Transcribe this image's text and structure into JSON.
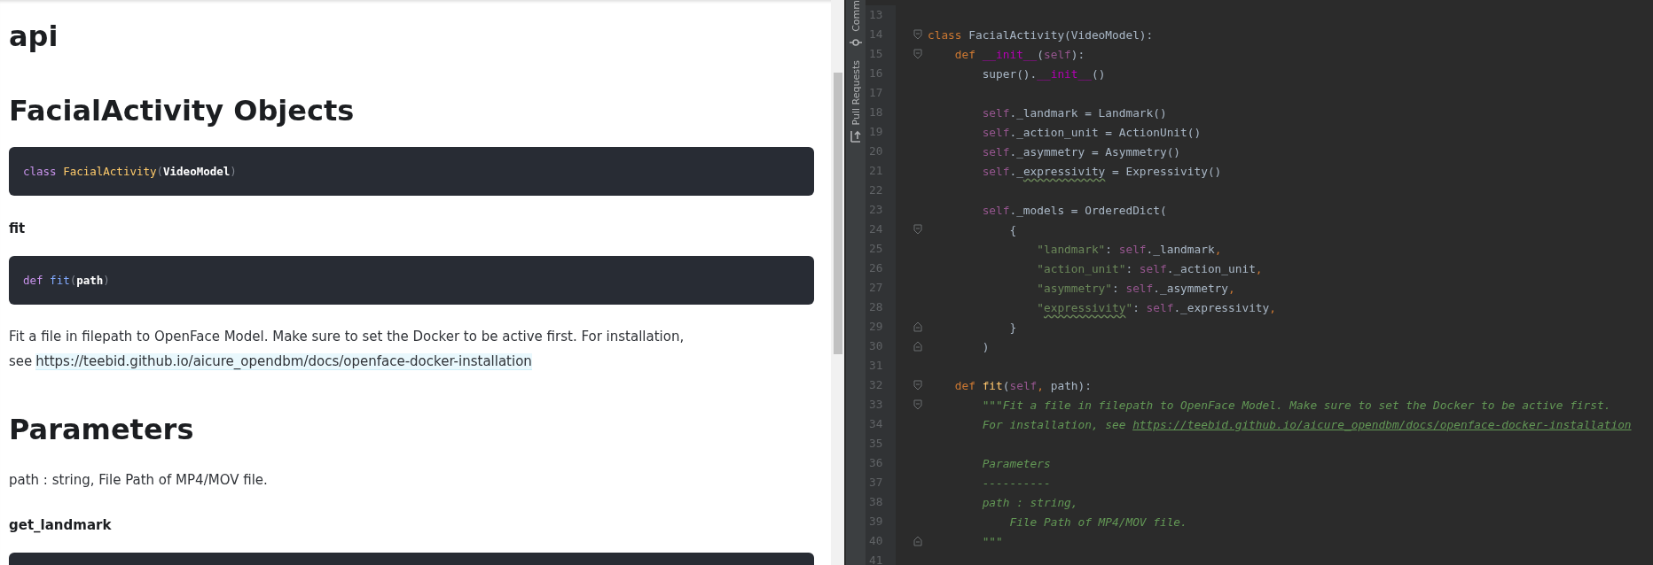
{
  "doc": {
    "blocks": [
      {
        "kind": "title",
        "text": "api"
      },
      {
        "kind": "heading",
        "text": "FacialActivity Objects"
      },
      {
        "kind": "code",
        "tokens": [
          {
            "kind": "keyword",
            "text": "class "
          },
          {
            "kind": "classname",
            "text": "FacialActivity"
          },
          {
            "kind": "paren",
            "text": "("
          },
          {
            "kind": "param",
            "text": "VideoModel"
          },
          {
            "kind": "paren",
            "text": ")"
          }
        ]
      },
      {
        "kind": "subheading",
        "text": "fit"
      },
      {
        "kind": "code",
        "tokens": [
          {
            "kind": "keyword",
            "text": "def "
          },
          {
            "kind": "func",
            "text": "fit"
          },
          {
            "kind": "paren",
            "text": "("
          },
          {
            "kind": "param",
            "text": "path"
          },
          {
            "kind": "paren",
            "text": ")"
          }
        ]
      },
      {
        "kind": "paragraph",
        "text": "Fit a file in filepath to OpenFace Model. Make sure to set the Docker to be active first. For installation, see",
        "link": "https://teebid.github.io/aicure_opendbm/docs/openface-docker-installation"
      },
      {
        "kind": "heading",
        "text": "Parameters"
      },
      {
        "kind": "paragraph",
        "text": "path : string, File Path of MP4/MOV file."
      },
      {
        "kind": "subheading",
        "text": "get_landmark"
      },
      {
        "kind": "code"
      }
    ]
  },
  "tool_strip": [
    {
      "kind": "commit",
      "label": "Comm"
    },
    {
      "kind": "pull",
      "label": "Pull Requests"
    }
  ],
  "editor": {
    "lines": [
      {
        "number": "13",
        "kind": "plain"
      },
      {
        "number": "14",
        "kind": "fold_start",
        "tokens": [
          {
            "kind": "keyword",
            "text": "class"
          },
          {
            "kind": "plain",
            "text": " FacialActivity(VideoModel):"
          }
        ]
      },
      {
        "number": "15",
        "kind": "fold_start",
        "tokens": [
          {
            "kind": "keyword",
            "text": "    def "
          },
          {
            "kind": "magic",
            "text": "__init__"
          },
          {
            "kind": "plain",
            "text": "("
          },
          {
            "kind": "self",
            "text": "self"
          },
          {
            "kind": "plain",
            "text": "):"
          }
        ]
      },
      {
        "number": "16",
        "kind": "plain",
        "tokens": [
          {
            "kind": "plain",
            "text": "        super()."
          },
          {
            "kind": "magic",
            "text": "__init__"
          },
          {
            "kind": "plain",
            "text": "()"
          }
        ]
      },
      {
        "number": "17",
        "kind": "plain"
      },
      {
        "number": "18",
        "kind": "plain",
        "tokens": [
          {
            "kind": "self",
            "text": "        self"
          },
          {
            "kind": "plain",
            "text": "._landmark = Landmark()"
          }
        ]
      },
      {
        "number": "19",
        "kind": "plain",
        "tokens": [
          {
            "kind": "self",
            "text": "        self"
          },
          {
            "kind": "plain",
            "text": "._action_unit = ActionUnit()"
          }
        ]
      },
      {
        "number": "20",
        "kind": "plain",
        "tokens": [
          {
            "kind": "self",
            "text": "        self"
          },
          {
            "kind": "plain",
            "text": "._asymmetry = Asymmetry()"
          }
        ]
      },
      {
        "number": "21",
        "kind": "plain",
        "tokens": [
          {
            "kind": "self",
            "text": "        self"
          },
          {
            "kind": "plain",
            "text": "._"
          },
          {
            "kind": "typo",
            "text": "expressivity"
          },
          {
            "kind": "plain",
            "text": " = Expressivity()"
          }
        ]
      },
      {
        "number": "22",
        "kind": "plain"
      },
      {
        "number": "23",
        "kind": "plain",
        "tokens": [
          {
            "kind": "self",
            "text": "        self"
          },
          {
            "kind": "plain",
            "text": "._models = OrderedDict("
          }
        ]
      },
      {
        "number": "24",
        "kind": "fold_start",
        "tokens": [
          {
            "kind": "plain",
            "text": "            {"
          }
        ]
      },
      {
        "number": "25",
        "kind": "plain",
        "tokens": [
          {
            "kind": "string",
            "text": "                \"landmark\""
          },
          {
            "kind": "plain",
            "text": ": "
          },
          {
            "kind": "self",
            "text": "self"
          },
          {
            "kind": "plain",
            "text": "._landmark"
          },
          {
            "kind": "comma",
            "text": ","
          }
        ]
      },
      {
        "number": "26",
        "kind": "plain",
        "tokens": [
          {
            "kind": "string",
            "text": "                \"action_unit\""
          },
          {
            "kind": "plain",
            "text": ": "
          },
          {
            "kind": "self",
            "text": "self"
          },
          {
            "kind": "plain",
            "text": "._action_unit"
          },
          {
            "kind": "comma",
            "text": ","
          }
        ]
      },
      {
        "number": "27",
        "kind": "plain",
        "tokens": [
          {
            "kind": "string",
            "text": "                \"asymmetry\""
          },
          {
            "kind": "plain",
            "text": ": "
          },
          {
            "kind": "self",
            "text": "self"
          },
          {
            "kind": "plain",
            "text": "._asymmetry"
          },
          {
            "kind": "comma",
            "text": ","
          }
        ]
      },
      {
        "number": "28",
        "kind": "plain",
        "tokens": [
          {
            "kind": "string",
            "text": "                \""
          },
          {
            "kind": "typostring",
            "text": "expressivity"
          },
          {
            "kind": "string",
            "text": "\""
          },
          {
            "kind": "plain",
            "text": ": "
          },
          {
            "kind": "self",
            "text": "self"
          },
          {
            "kind": "plain",
            "text": "._expressivity"
          },
          {
            "kind": "comma",
            "text": ","
          }
        ]
      },
      {
        "number": "29",
        "kind": "fold_end",
        "tokens": [
          {
            "kind": "plain",
            "text": "            }"
          }
        ]
      },
      {
        "number": "30",
        "kind": "fold_end",
        "tokens": [
          {
            "kind": "plain",
            "text": "        )"
          }
        ]
      },
      {
        "number": "31",
        "kind": "plain"
      },
      {
        "number": "32",
        "kind": "fold_start",
        "tokens": [
          {
            "kind": "keyword",
            "text": "    def "
          },
          {
            "kind": "func",
            "text": "fit"
          },
          {
            "kind": "plain",
            "text": "("
          },
          {
            "kind": "self",
            "text": "self"
          },
          {
            "kind": "comma",
            "text": ","
          },
          {
            "kind": "plain",
            "text": " path):"
          }
        ]
      },
      {
        "number": "33",
        "kind": "fold_start",
        "tokens": [
          {
            "kind": "comment",
            "text": "        \"\"\"Fit a file in filepath to OpenFace Model. Make sure to set the Docker to be active first."
          }
        ]
      },
      {
        "number": "34",
        "kind": "plain",
        "tokens": [
          {
            "kind": "comment",
            "text": "        For installation, see "
          },
          {
            "kind": "link",
            "text": "https://teebid.github.io/aicure_opendbm/docs/openface-docker-installation"
          }
        ]
      },
      {
        "number": "35",
        "kind": "plain"
      },
      {
        "number": "36",
        "kind": "plain",
        "tokens": [
          {
            "kind": "comment",
            "text": "        Parameters"
          }
        ]
      },
      {
        "number": "37",
        "kind": "plain",
        "tokens": [
          {
            "kind": "comment",
            "text": "        ----------"
          }
        ]
      },
      {
        "number": "38",
        "kind": "plain",
        "tokens": [
          {
            "kind": "comment",
            "text": "        path : string,"
          }
        ]
      },
      {
        "number": "39",
        "kind": "plain",
        "tokens": [
          {
            "kind": "comment",
            "text": "            File Path of MP4/MOV file."
          }
        ]
      },
      {
        "number": "40",
        "kind": "fold_end",
        "tokens": [
          {
            "kind": "comment",
            "text": "        \"\"\""
          }
        ]
      },
      {
        "number": "41",
        "kind": "plain"
      }
    ]
  }
}
